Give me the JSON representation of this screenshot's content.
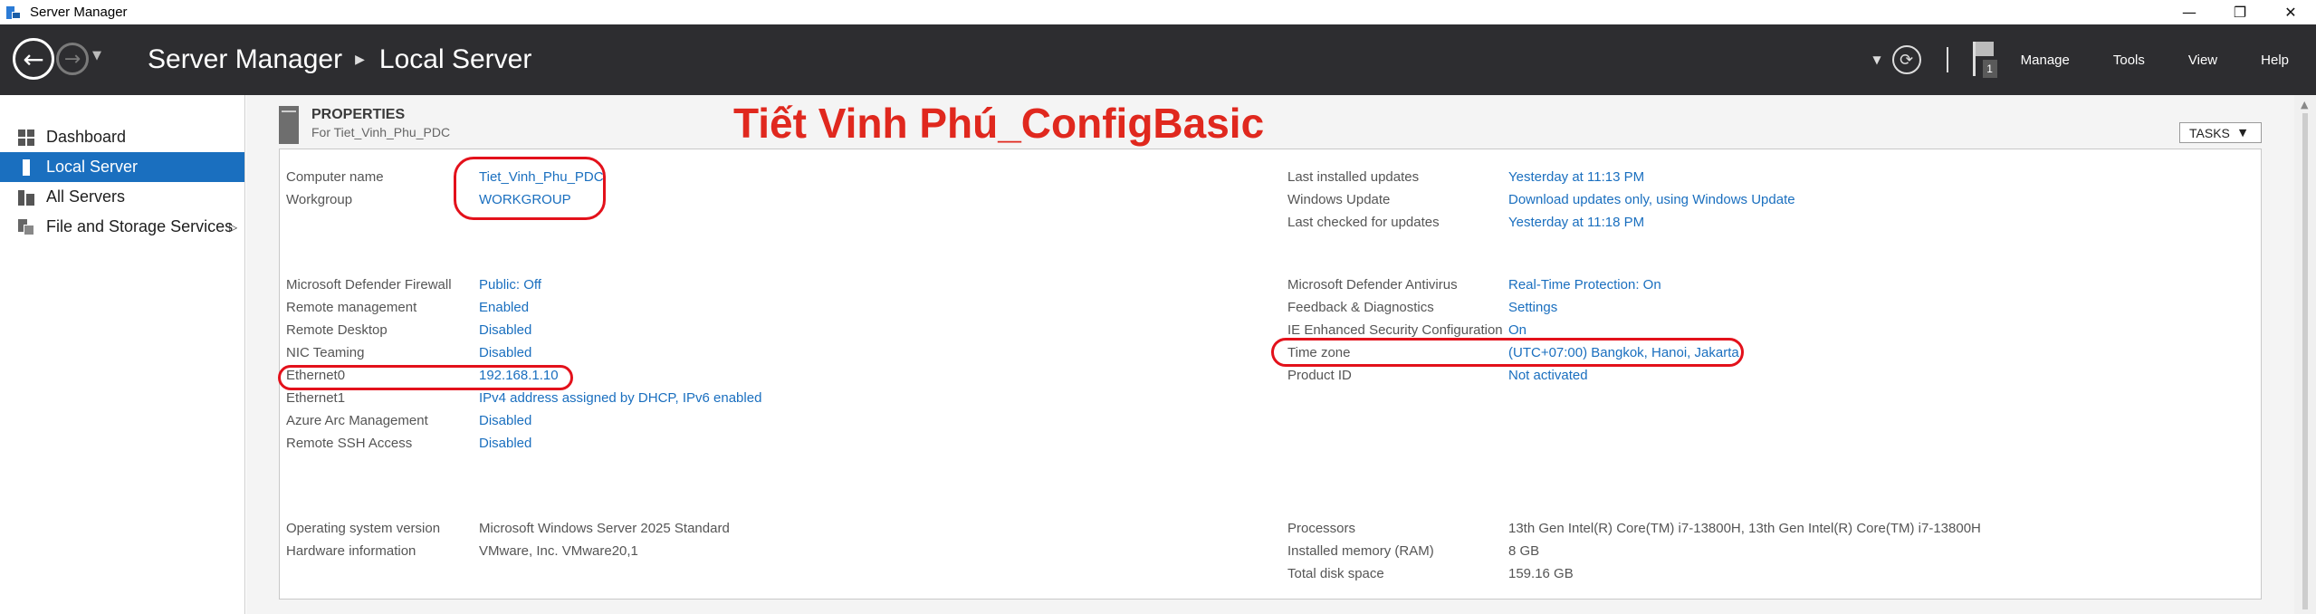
{
  "window": {
    "title": "Server Manager",
    "minimize": "—",
    "restore": "❐",
    "close": "✕"
  },
  "header": {
    "app_name": "Server Manager",
    "current_page": "Local Server",
    "notification_count": "1",
    "menu": [
      "Manage",
      "Tools",
      "View",
      "Help"
    ]
  },
  "sidebar": {
    "items": [
      {
        "label": "Dashboard",
        "icon": "dashboard-icon"
      },
      {
        "label": "Local Server",
        "icon": "local-server-icon",
        "active": true
      },
      {
        "label": "All Servers",
        "icon": "all-servers-icon"
      },
      {
        "label": "File and Storage Services",
        "icon": "file-storage-icon"
      }
    ]
  },
  "properties": {
    "title": "PROPERTIES",
    "subtitle": "For Tiet_Vinh_Phu_PDC",
    "tasks_label": "TASKS",
    "banner": "Tiết Vinh Phú_ConfigBasic",
    "left_group1": [
      {
        "label": "Computer name",
        "value": "Tiet_Vinh_Phu_PDC"
      },
      {
        "label": "Workgroup",
        "value": "WORKGROUP"
      }
    ],
    "left_group2": [
      {
        "label": "Microsoft Defender Firewall",
        "value": "Public: Off"
      },
      {
        "label": "Remote management",
        "value": "Enabled"
      },
      {
        "label": "Remote Desktop",
        "value": "Disabled"
      },
      {
        "label": "NIC Teaming",
        "value": "Disabled"
      },
      {
        "label": "Ethernet0",
        "value": "192.168.1.10"
      },
      {
        "label": "Ethernet1",
        "value": "IPv4 address assigned by DHCP, IPv6 enabled"
      },
      {
        "label": "Azure Arc Management",
        "value": "Disabled"
      },
      {
        "label": "Remote SSH Access",
        "value": "Disabled"
      }
    ],
    "left_group3": [
      {
        "label": "Operating system version",
        "value": "Microsoft Windows Server 2025 Standard"
      },
      {
        "label": "Hardware information",
        "value": "VMware, Inc. VMware20,1"
      }
    ],
    "right_group1": [
      {
        "label": "Last installed updates",
        "value": "Yesterday at 11:13 PM"
      },
      {
        "label": "Windows Update",
        "value": "Download updates only, using Windows Update"
      },
      {
        "label": "Last checked for updates",
        "value": "Yesterday at 11:18 PM"
      }
    ],
    "right_group2": [
      {
        "label": "Microsoft Defender Antivirus",
        "value": "Real-Time Protection: On"
      },
      {
        "label": "Feedback & Diagnostics",
        "value": "Settings"
      },
      {
        "label": "IE Enhanced Security Configuration",
        "value": "On"
      },
      {
        "label": "Time zone",
        "value": "(UTC+07:00) Bangkok, Hanoi, Jakarta"
      },
      {
        "label": "Product ID",
        "value": "Not activated"
      }
    ],
    "right_group3": [
      {
        "label": "Processors",
        "value": "13th Gen Intel(R) Core(TM) i7-13800H, 13th Gen Intel(R) Core(TM) i7-13800H"
      },
      {
        "label": "Installed memory (RAM)",
        "value": "8 GB"
      },
      {
        "label": "Total disk space",
        "value": "159.16 GB"
      }
    ]
  },
  "colors": {
    "header_bg": "#2d2d30",
    "accent": "#1a6fbf",
    "highlight": "#e3111b"
  }
}
